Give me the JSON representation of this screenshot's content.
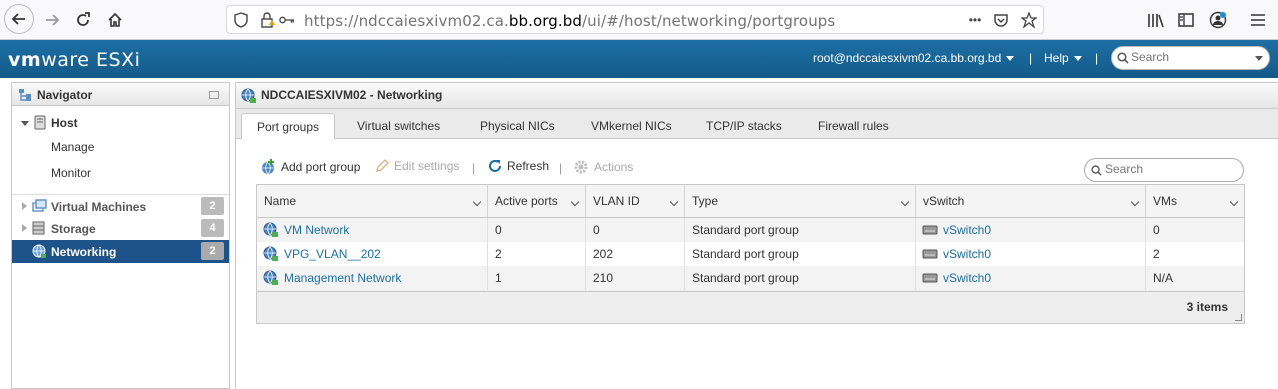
{
  "browser": {
    "url_prefix": "https://ndccaiesxivm02.ca.",
    "url_host": "bb.org.bd",
    "url_suffix": "/ui/#/host/networking/portgroups",
    "menu_dots": "•••"
  },
  "header": {
    "brand_vm": "vm",
    "brand_ware": "ware",
    "brand_product": "ESXi",
    "user": "root@ndccaiesxivm02.ca.bb.org.bd",
    "help": "Help",
    "separator": "|",
    "search_placeholder": "Search"
  },
  "navigator": {
    "title": "Navigator",
    "items": [
      {
        "label": "Host"
      },
      {
        "label": "Manage"
      },
      {
        "label": "Monitor"
      },
      {
        "label": "Virtual Machines",
        "badge": "2"
      },
      {
        "label": "Storage",
        "badge": "4"
      },
      {
        "label": "Networking",
        "badge": "2"
      }
    ]
  },
  "main": {
    "title": "NDCCAIESXIVM02 - Networking",
    "tabs": [
      "Port groups",
      "Virtual switches",
      "Physical NICs",
      "VMkernel NICs",
      "TCP/IP stacks",
      "Firewall rules"
    ],
    "toolbar": {
      "add": "Add port group",
      "edit": "Edit settings",
      "refresh": "Refresh",
      "actions": "Actions",
      "sep": "|"
    },
    "search_placeholder": "Search",
    "columns": [
      "Name",
      "Active ports",
      "VLAN ID",
      "Type",
      "vSwitch",
      "VMs"
    ],
    "rows": [
      {
        "name": "VM Network",
        "active_ports": "0",
        "vlan_id": "0",
        "type": "Standard port group",
        "vswitch": "vSwitch0",
        "vms": "0"
      },
      {
        "name": "VPG_VLAN__202",
        "active_ports": "2",
        "vlan_id": "202",
        "type": "Standard port group",
        "vswitch": "vSwitch0",
        "vms": "2"
      },
      {
        "name": "Management Network",
        "active_ports": "1",
        "vlan_id": "210",
        "type": "Standard port group",
        "vswitch": "vSwitch0",
        "vms": "N/A"
      }
    ],
    "items_count": "3 items"
  },
  "colors": {
    "header_blue": "#1c6fa4",
    "selected_nav": "#1d5389",
    "link": "#1a6fa8"
  }
}
